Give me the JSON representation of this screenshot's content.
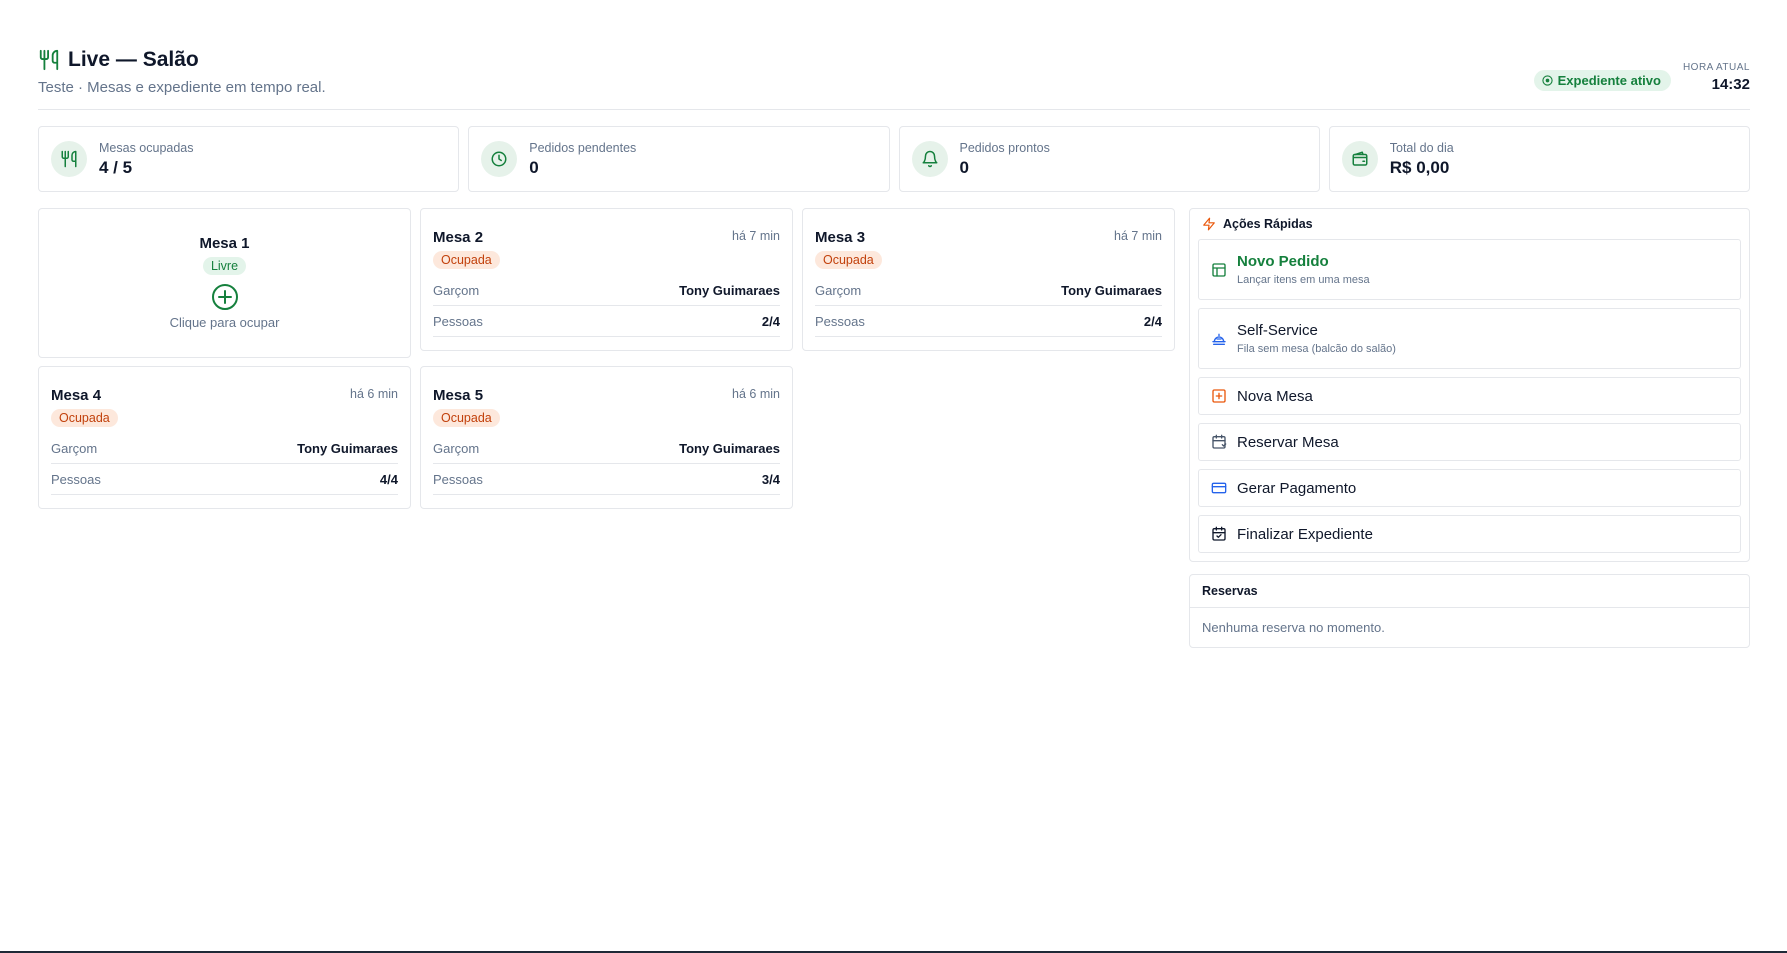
{
  "header": {
    "title": "Live — Salão",
    "subtitle": "Teste · Mesas e expediente em tempo real.",
    "status": "Expediente ativo",
    "clock_label": "HORA ATUAL",
    "clock_time": "14:32"
  },
  "stats": [
    {
      "label": "Mesas ocupadas",
      "value": "4 / 5",
      "icon": "utensils-icon"
    },
    {
      "label": "Pedidos pendentes",
      "value": "0",
      "icon": "clock-icon"
    },
    {
      "label": "Pedidos prontos",
      "value": "0",
      "icon": "bell-icon"
    },
    {
      "label": "Total do dia",
      "value": "R$ 0,00",
      "icon": "wallet-icon"
    }
  ],
  "tables": {
    "free": {
      "name": "Mesa 1",
      "status": "Livre",
      "hint": "Clique para ocupar"
    },
    "occupied": [
      {
        "name": "Mesa 2",
        "status": "Ocupada",
        "time": "há 7 min",
        "waiter_label": "Garçom",
        "waiter": "Tony Guimaraes",
        "people_label": "Pessoas",
        "people": "2/4"
      },
      {
        "name": "Mesa 3",
        "status": "Ocupada",
        "time": "há 7 min",
        "waiter_label": "Garçom",
        "waiter": "Tony Guimaraes",
        "people_label": "Pessoas",
        "people": "2/4"
      },
      {
        "name": "Mesa 4",
        "status": "Ocupada",
        "time": "há 6 min",
        "waiter_label": "Garçom",
        "waiter": "Tony Guimaraes",
        "people_label": "Pessoas",
        "people": "4/4"
      },
      {
        "name": "Mesa 5",
        "status": "Ocupada",
        "time": "há 6 min",
        "waiter_label": "Garçom",
        "waiter": "Tony Guimaraes",
        "people_label": "Pessoas",
        "people": "3/4"
      }
    ]
  },
  "quick_actions": {
    "title": "Ações Rápidas",
    "items": [
      {
        "title": "Novo Pedido",
        "subtitle": "Lançar itens em uma mesa",
        "icon": "table-icon"
      },
      {
        "title": "Self-Service",
        "subtitle": "Fila sem mesa (balcão do salão)",
        "icon": "dish-icon"
      },
      {
        "title": "Nova Mesa",
        "icon": "plus-square-icon"
      },
      {
        "title": "Reservar Mesa",
        "icon": "calendar-icon"
      },
      {
        "title": "Gerar Pagamento",
        "icon": "credit-card-icon"
      },
      {
        "title": "Finalizar Expediente",
        "icon": "calendar-check-icon"
      }
    ]
  },
  "reservations": {
    "title": "Reservas",
    "empty": "Nenhuma reserva no momento."
  },
  "colors": {
    "accent": "#15803d",
    "accent_bg": "#e3f4ea",
    "occupied_text": "#c2410c",
    "occupied_bg": "#fde8dc",
    "muted": "#64748b",
    "border": "#e5e7eb"
  }
}
